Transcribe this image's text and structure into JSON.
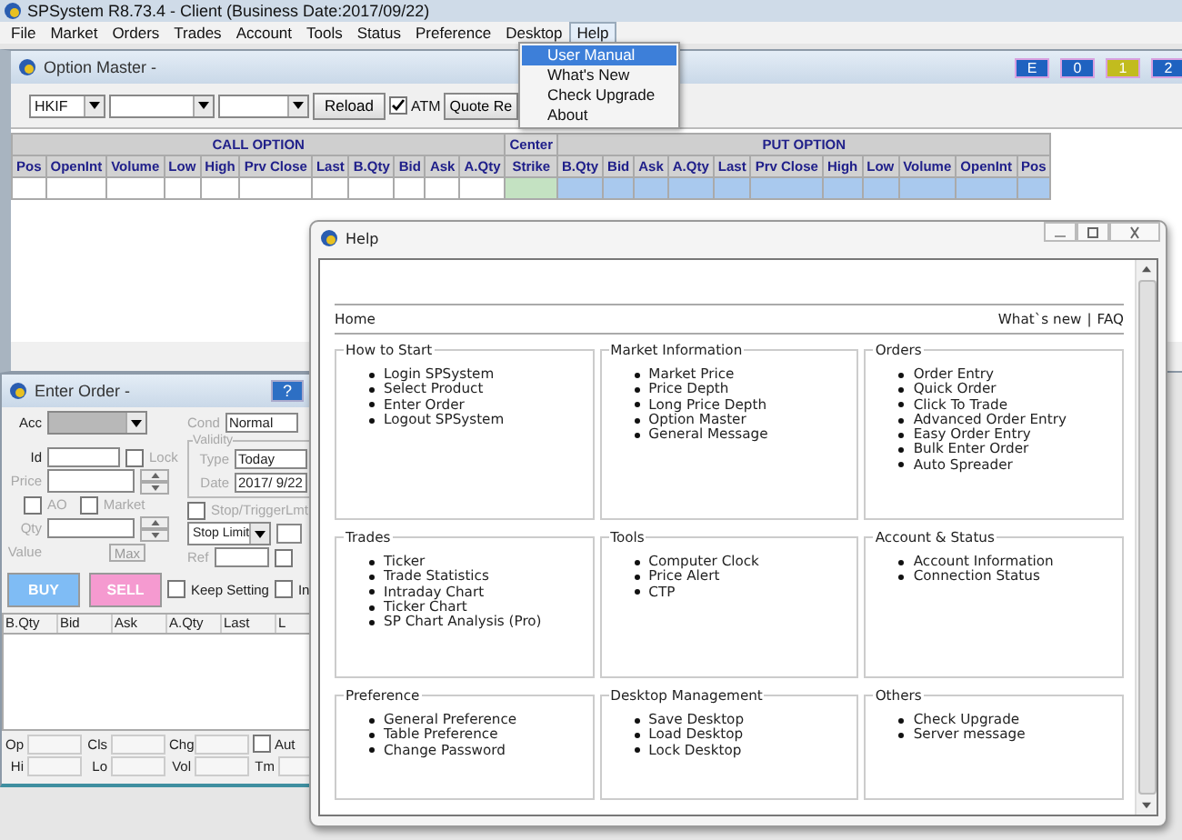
{
  "window": {
    "title": "SPSystem R8.73.4 - Client (Business Date:2017/09/22)"
  },
  "menu": [
    {
      "label": "File",
      "selected": false
    },
    {
      "label": "Market",
      "selected": false
    },
    {
      "label": "Orders",
      "selected": false
    },
    {
      "label": "Trades",
      "selected": false
    },
    {
      "label": "Account",
      "selected": false
    },
    {
      "label": "Tools",
      "selected": false
    },
    {
      "label": "Status",
      "selected": false
    },
    {
      "label": "Preference",
      "selected": false
    },
    {
      "label": "Desktop",
      "selected": false
    },
    {
      "label": "Help",
      "selected": true
    }
  ],
  "help_menu": [
    {
      "label": "User Manual",
      "selected": true
    },
    {
      "label": "What's New",
      "selected": false
    },
    {
      "label": "Check Upgrade",
      "selected": false
    },
    {
      "label": "About",
      "selected": false
    }
  ],
  "option_master": {
    "title": "Option Master -",
    "indicators": [
      {
        "label": "E",
        "color": "#1f62c0"
      },
      {
        "label": "0",
        "color": "#1f62c0"
      },
      {
        "label": "1",
        "color": "#c2bc1e"
      },
      {
        "label": "2",
        "color": "#1f62c0"
      }
    ],
    "product": "HKIF",
    "reload_button": "Reload",
    "atm": {
      "label": "ATM",
      "checked": true
    },
    "quote_button": "Quote Re",
    "groups": [
      {
        "label": "CALL OPTION",
        "kind": "call"
      },
      {
        "label": "Center",
        "kind": "center"
      },
      {
        "label": "PUT OPTION",
        "kind": "put"
      }
    ],
    "columns": [
      {
        "label": "Pos",
        "kind": "call"
      },
      {
        "label": "OpenInt",
        "kind": "call"
      },
      {
        "label": "Volume",
        "kind": "call"
      },
      {
        "label": "Low",
        "kind": "call"
      },
      {
        "label": "High",
        "kind": "call"
      },
      {
        "label": "Prv Close",
        "kind": "call"
      },
      {
        "label": "Last",
        "kind": "call"
      },
      {
        "label": "B.Qty",
        "kind": "call"
      },
      {
        "label": "Bid",
        "kind": "call"
      },
      {
        "label": "Ask",
        "kind": "call"
      },
      {
        "label": "A.Qty",
        "kind": "call"
      },
      {
        "label": "Strike",
        "kind": "center"
      },
      {
        "label": "B.Qty",
        "kind": "put"
      },
      {
        "label": "Bid",
        "kind": "put"
      },
      {
        "label": "Ask",
        "kind": "put"
      },
      {
        "label": "A.Qty",
        "kind": "put"
      },
      {
        "label": "Last",
        "kind": "put"
      },
      {
        "label": "Prv Close",
        "kind": "put"
      },
      {
        "label": "High",
        "kind": "put"
      },
      {
        "label": "Low",
        "kind": "put"
      },
      {
        "label": "Volume",
        "kind": "put"
      },
      {
        "label": "OpenInt",
        "kind": "put"
      },
      {
        "label": "Pos",
        "kind": "put"
      }
    ]
  },
  "enter_order": {
    "title": "Enter Order -",
    "help_button": "?",
    "acc": {
      "text": "Acc",
      "disabled": false
    },
    "cond": {
      "text": "Cond",
      "disabled": true,
      "value": "Normal"
    },
    "id": {
      "text": "Id",
      "disabled": false
    },
    "lock": {
      "text": "Lock",
      "disabled": true,
      "checked": false
    },
    "validity": {
      "text": "Validity",
      "disabled": true
    },
    "type": {
      "text": "Type",
      "disabled": true,
      "value": "Today"
    },
    "date": {
      "text": "Date",
      "disabled": true,
      "value": "2017/ 9/22"
    },
    "price": {
      "text": "Price",
      "disabled": true
    },
    "ao": {
      "text": "AO",
      "disabled": true,
      "checked": false
    },
    "market": {
      "text": "Market",
      "disabled": true,
      "checked": false
    },
    "stop": {
      "text": "Stop/TriggerLmt",
      "disabled": true,
      "checked": false
    },
    "stop_type": "Stop Limit",
    "qty": {
      "text": "Qty",
      "disabled": true
    },
    "value": {
      "text": "Value",
      "disabled": true
    },
    "max_button": "Max",
    "ref": {
      "text": "Ref",
      "disabled": true
    },
    "ref_check": {
      "checked": false
    },
    "buy_button": "BUY",
    "sell_button": "SELL",
    "keep": {
      "text": "Keep Setting",
      "disabled": false,
      "checked": false
    },
    "ins": {
      "text": "In",
      "disabled": false,
      "checked": false
    },
    "columns": [
      "B.Qty",
      "Bid",
      "Ask",
      "A.Qty",
      "Last",
      "L"
    ],
    "stats_row_1": [
      "Op",
      "Cls",
      "Chg"
    ],
    "auto": {
      "text": "Aut",
      "disabled": false,
      "checked": false
    },
    "stats_row_2": [
      "Hi",
      "Lo",
      "Vol",
      "Tm"
    ]
  },
  "help": {
    "title": "Help",
    "home_link": "Home",
    "whats_new_link": "What`s new",
    "separator": "|",
    "faq_link": "FAQ",
    "sections": [
      {
        "title": "How to Start",
        "items": [
          "Login SPSystem",
          "Select Product",
          "Enter Order",
          "Logout SPSystem"
        ]
      },
      {
        "title": "Market Information",
        "items": [
          "Market Price",
          "Price Depth",
          "Long Price Depth",
          "Option Master",
          "General Message"
        ]
      },
      {
        "title": "Orders",
        "items": [
          "Order Entry",
          "Quick Order",
          "Click To Trade",
          "Advanced Order Entry",
          "Easy Order Entry",
          "Bulk Enter Order",
          "Auto Spreader"
        ]
      },
      {
        "title": "Trades",
        "items": [
          "Ticker",
          "Trade Statistics",
          "Intraday Chart",
          "Ticker Chart",
          "SP Chart Analysis (Pro)"
        ]
      },
      {
        "title": "Tools",
        "items": [
          "Computer Clock",
          "Price Alert",
          "CTP"
        ]
      },
      {
        "title": "Account & Status",
        "items": [
          "Account Information",
          "Connection Status"
        ]
      },
      {
        "title": "Preference",
        "items": [
          "General Preference",
          "Table Preference",
          "Change Password"
        ]
      },
      {
        "title": "Desktop Management",
        "items": [
          "Save Desktop",
          "Load Desktop",
          "Lock Desktop"
        ]
      },
      {
        "title": "Others",
        "items": [
          "Check Upgrade",
          "Server message"
        ]
      }
    ]
  }
}
